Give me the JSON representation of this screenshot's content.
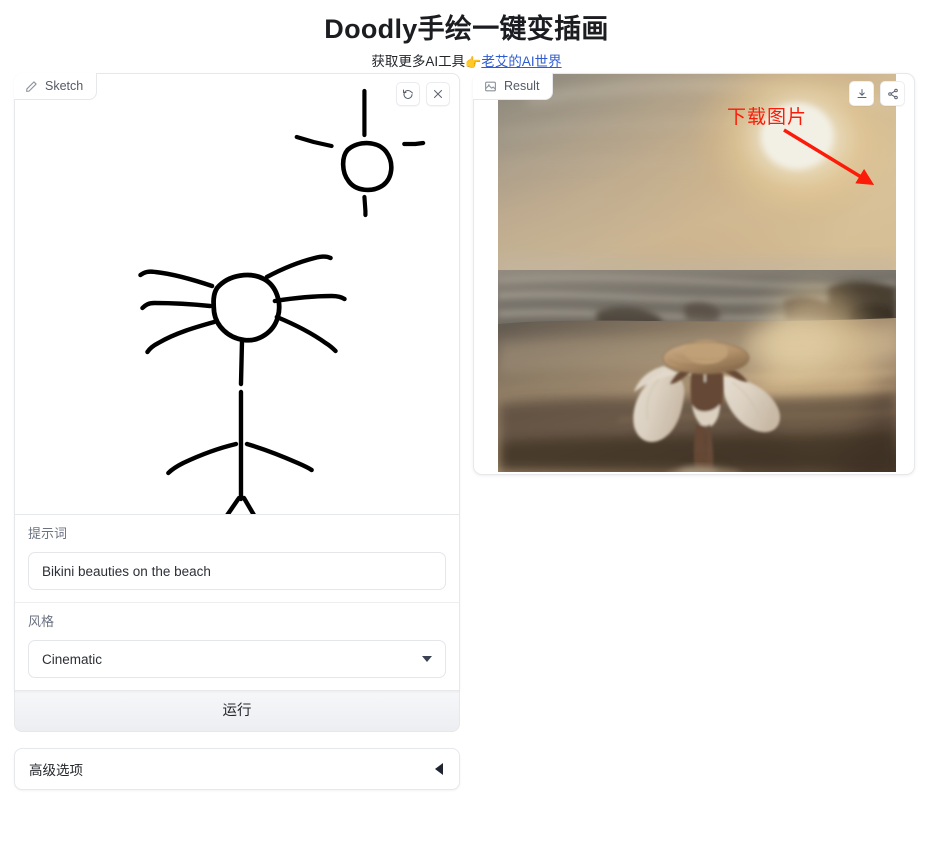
{
  "header": {
    "title": "Doodly手绘一键变插画",
    "subtitle_prefix": "获取更多AI工具",
    "subtitle_hand_icon": "pointing-hand-right-emoji",
    "subtitle_hand": "👉",
    "link_text": "老艾的AI世界"
  },
  "annotation": {
    "text": "下载图片",
    "color": "#fb1b08"
  },
  "sketch_panel": {
    "tab_label": "Sketch",
    "tab_icon": "pencil-icon",
    "undo_icon": "undo-rotate-icon",
    "clear_icon": "close-x-icon",
    "drawing_description": "stick figure with round head and radiating rays plus a sun with four rays"
  },
  "result_panel": {
    "tab_label": "Result",
    "tab_icon": "image-icon",
    "download_icon": "download-icon",
    "share_icon": "share-nodes-icon",
    "image_description": "beach sunset with a woman in a wide-brim sun hat walking into the surf"
  },
  "form": {
    "prompt": {
      "label": "提示词",
      "value": "Bikini beauties on the beach",
      "placeholder": "提示词"
    },
    "style": {
      "label": "风格",
      "value": "Cinematic"
    },
    "run_label": "运行",
    "advanced_label": "高级选项"
  }
}
